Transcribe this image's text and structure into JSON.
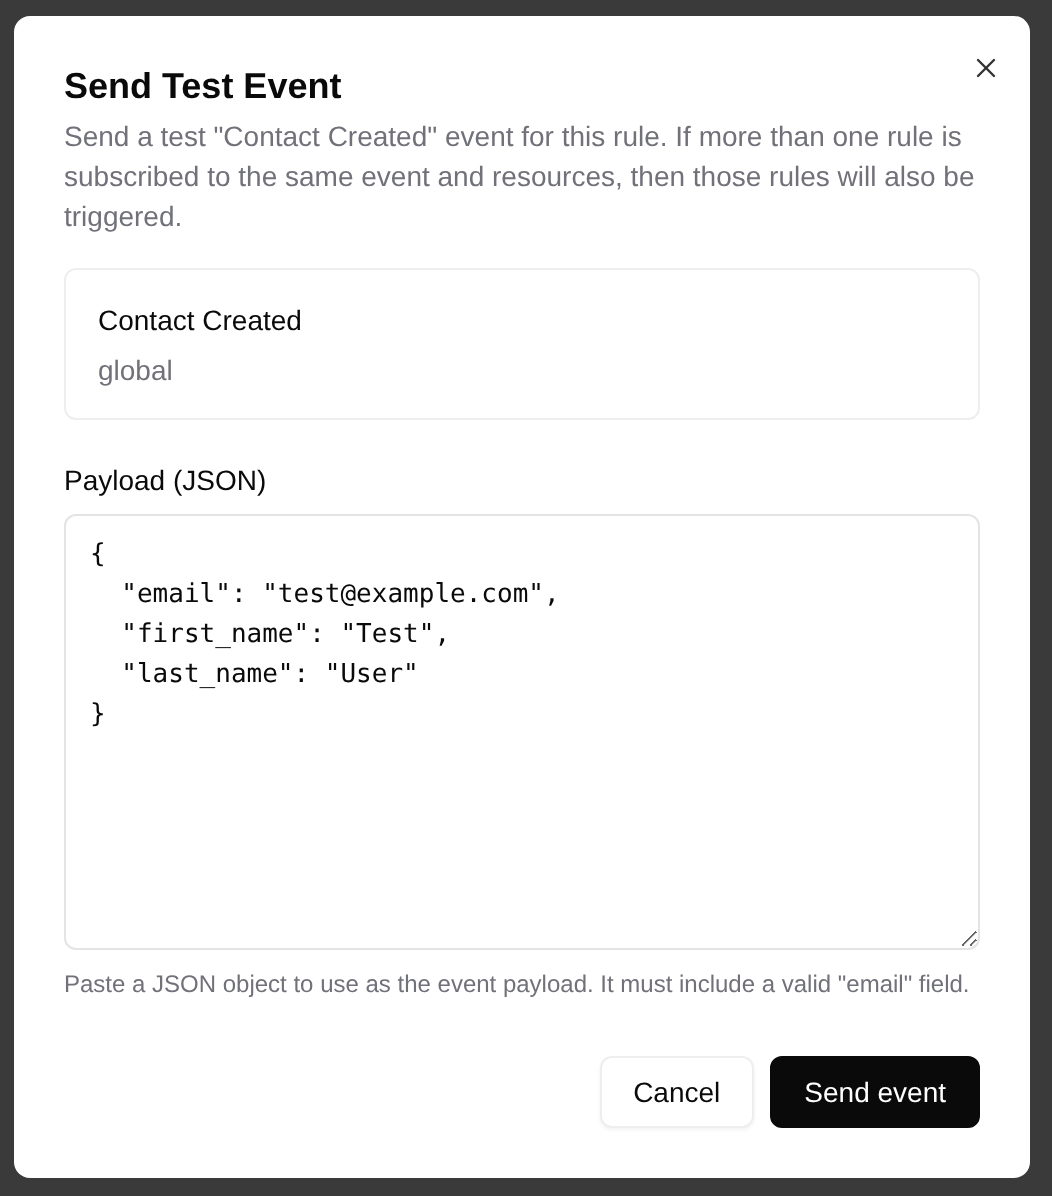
{
  "dialog": {
    "title": "Send Test Event",
    "description": "Send a test \"Contact Created\" event for this rule. If more than one rule is subscribed to the same event and resources, then those rules will also be triggered.",
    "event_card": {
      "name": "Contact Created",
      "scope": "global"
    },
    "payload": {
      "label": "Payload (JSON)",
      "value": "{\n  \"email\": \"test@example.com\",\n  \"first_name\": \"Test\",\n  \"last_name\": \"User\"\n}",
      "hint": "Paste a JSON object to use as the event payload. It must include a valid \"email\" field."
    },
    "buttons": [
      {
        "label": "Cancel",
        "kind": "secondary"
      },
      {
        "label": "Send event",
        "kind": "primary"
      }
    ]
  }
}
